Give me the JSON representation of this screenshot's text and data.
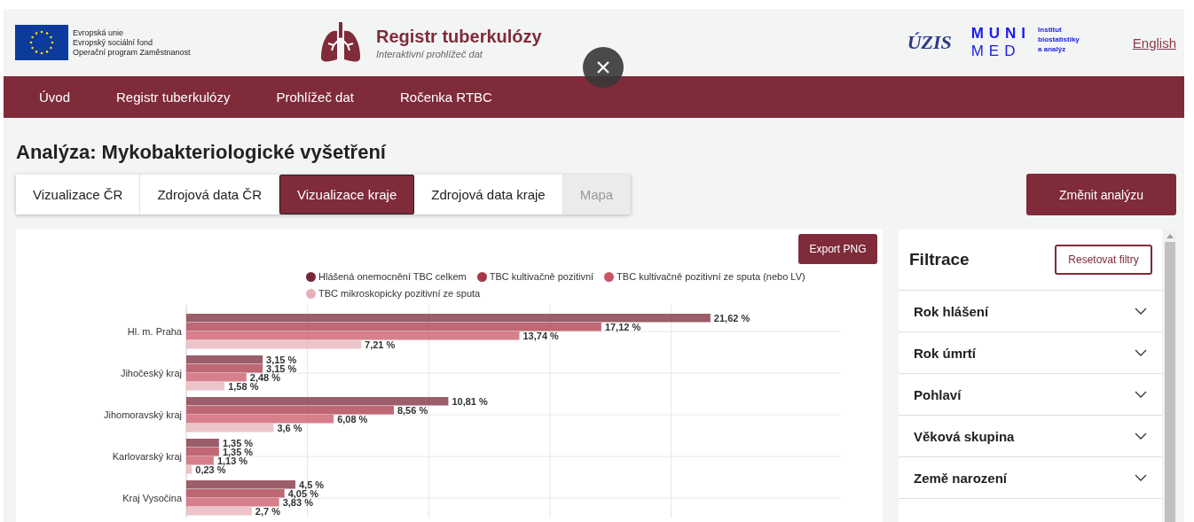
{
  "header": {
    "eu_logo": {
      "lines": [
        "Evropská unie",
        "Evropský sociální fond",
        "Operační program Zaměstnanost"
      ]
    },
    "site": {
      "title": "Registr tuberkulózy",
      "subtitle": "Interaktivní prohlížeč dat"
    },
    "uzis_logo": {
      "text": "ÚZIS"
    },
    "muni_logo": {
      "top": "MUNI",
      "bottom": "MED",
      "lines": [
        "Institut",
        "biostatistiky",
        "a analýz"
      ]
    },
    "language_link": "English"
  },
  "nav": [
    {
      "label": "Úvod"
    },
    {
      "label": "Registr tuberkulózy"
    },
    {
      "label": "Prohlížeč dat"
    },
    {
      "label": "Ročenka RTBC"
    }
  ],
  "page_title": "Analýza: Mykobakteriologické vyšetření",
  "tabs": [
    {
      "label": "Vizualizace ČR",
      "selected": false,
      "disabled": false
    },
    {
      "label": "Zdrojová data ČR",
      "selected": false,
      "disabled": false
    },
    {
      "label": "Vizualizace kraje",
      "selected": true,
      "disabled": false
    },
    {
      "label": "Zdrojová data kraje",
      "selected": false,
      "disabled": false
    },
    {
      "label": "Mapa",
      "selected": false,
      "disabled": true
    }
  ],
  "change_button": "Změnit analýzu",
  "chart_panel": {
    "export_button": "Export PNG",
    "chart_data": {
      "type": "bar",
      "orientation": "horizontal",
      "data_labels": true,
      "grid": true,
      "legend": true,
      "categories": [
        "Hl. m. Praha",
        "Jihočeský kraj",
        "Jihomoravský kraj",
        "Karlovarský kraj",
        "Kraj Vysočina"
      ],
      "series": [
        {
          "name": "Hlášená onemocnění TBC celkem",
          "color": "#7a2838",
          "values": [
            21.62,
            3.15,
            10.81,
            1.35,
            4.5
          ],
          "value_labels": [
            "21,62 %",
            "3,15 %",
            "10,81 %",
            "1,35 %",
            "4,5 %"
          ]
        },
        {
          "name": "TBC kultivačně pozitivní",
          "color": "#a93545",
          "values": [
            17.12,
            3.15,
            8.56,
            1.35,
            4.05
          ],
          "value_labels": [
            "17,12 %",
            "3,15 %",
            "8,56 %",
            "1,35 %",
            "4,05 %"
          ]
        },
        {
          "name": "TBC kultivačně pozitivní ze sputa (nebo LV)",
          "color": "#c95565",
          "values": [
            13.74,
            2.48,
            6.08,
            1.13,
            3.83
          ],
          "value_labels": [
            "13,74 %",
            "2,48 %",
            "6,08 %",
            "1,13 %",
            "3,83 %"
          ]
        },
        {
          "name": "TBC mikroskopicky pozitivní ze sputa",
          "color": "#e6b0b8",
          "values": [
            7.21,
            1.58,
            3.6,
            0.23,
            2.7
          ],
          "value_labels": [
            "7,21 %",
            "1,58 %",
            "3,6 %",
            "0,23 %",
            "2,7 %"
          ]
        }
      ]
    }
  },
  "filters": {
    "title": "Filtrace",
    "reset_button": "Resetovat filtry",
    "items": [
      {
        "label": "Rok hlášení",
        "expanded": false
      },
      {
        "label": "Rok úmrtí",
        "expanded": false
      },
      {
        "label": "Pohlaví",
        "expanded": false
      },
      {
        "label": "Věková skupina",
        "expanded": false
      },
      {
        "label": "Země narození",
        "expanded": false
      }
    ]
  }
}
